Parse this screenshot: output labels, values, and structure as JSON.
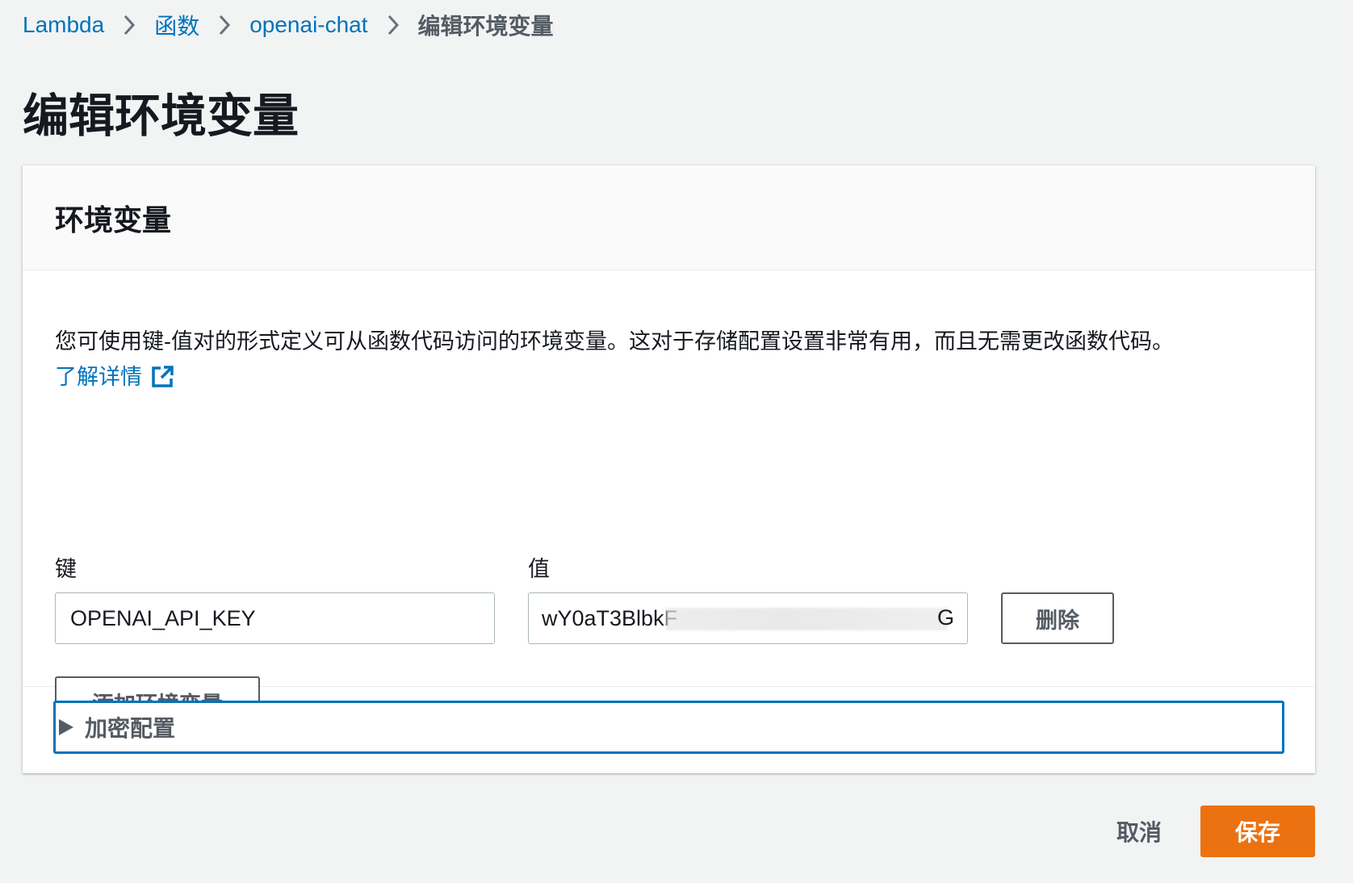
{
  "breadcrumb": {
    "items": [
      {
        "label": "Lambda"
      },
      {
        "label": "函数"
      },
      {
        "label": "openai-chat"
      },
      {
        "label": "编辑环境变量"
      }
    ]
  },
  "page": {
    "title": "编辑环境变量"
  },
  "env_section": {
    "header": "环境变量",
    "description": "您可使用键-值对的形式定义可从函数代码访问的环境变量。这对于存储配置设置非常有用，而且无需更改函数代码。",
    "learn_more": "了解详情",
    "key_label": "键",
    "value_label": "值",
    "variables": [
      {
        "key": "OPENAI_API_KEY",
        "value": "wY0aT3BlbkF",
        "value_tail": "G"
      }
    ],
    "remove_label": "删除",
    "add_label": "添加环境变量"
  },
  "encryption": {
    "label": "加密配置",
    "expanded": false
  },
  "actions": {
    "cancel_label": "取消",
    "save_label": "保存"
  },
  "colors": {
    "link": "#0073bb",
    "primary_button": "#ec7211",
    "focus_border": "#0073bb",
    "background": "#f2f3f3"
  }
}
